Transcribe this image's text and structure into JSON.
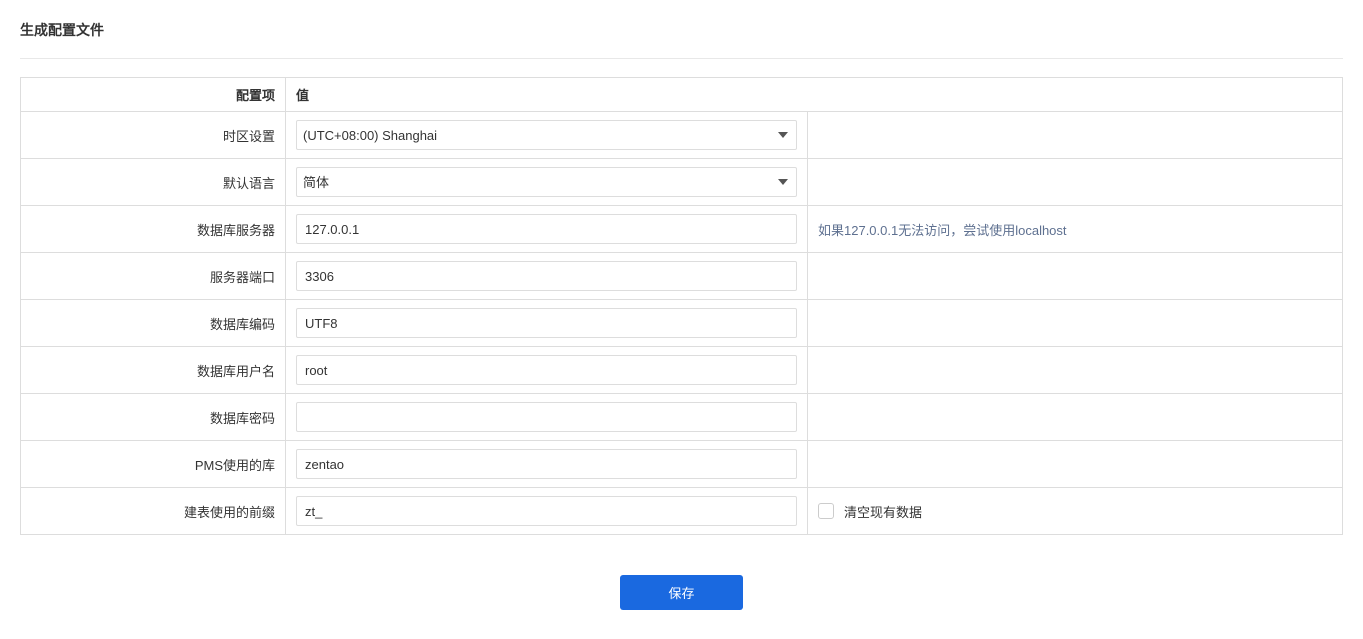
{
  "page": {
    "title": "生成配置文件"
  },
  "headers": {
    "config_item": "配置项",
    "value": "值"
  },
  "fields": {
    "timezone": {
      "label": "时区设置",
      "selected": "(UTC+08:00) Shanghai"
    },
    "default_lang": {
      "label": "默认语言",
      "selected": "简体"
    },
    "db_server": {
      "label": "数据库服务器",
      "value": "127.0.0.1",
      "hint": "如果127.0.0.1无法访问，尝试使用localhost"
    },
    "server_port": {
      "label": "服务器端口",
      "value": "3306"
    },
    "db_encoding": {
      "label": "数据库编码",
      "value": "UTF8"
    },
    "db_username": {
      "label": "数据库用户名",
      "value": "root"
    },
    "db_password": {
      "label": "数据库密码",
      "value": ""
    },
    "pms_db": {
      "label": "PMS使用的库",
      "value": "zentao"
    },
    "table_prefix": {
      "label": "建表使用的前缀",
      "value": "zt_",
      "checkbox_label": "清空现有数据"
    }
  },
  "buttons": {
    "save": "保存"
  }
}
